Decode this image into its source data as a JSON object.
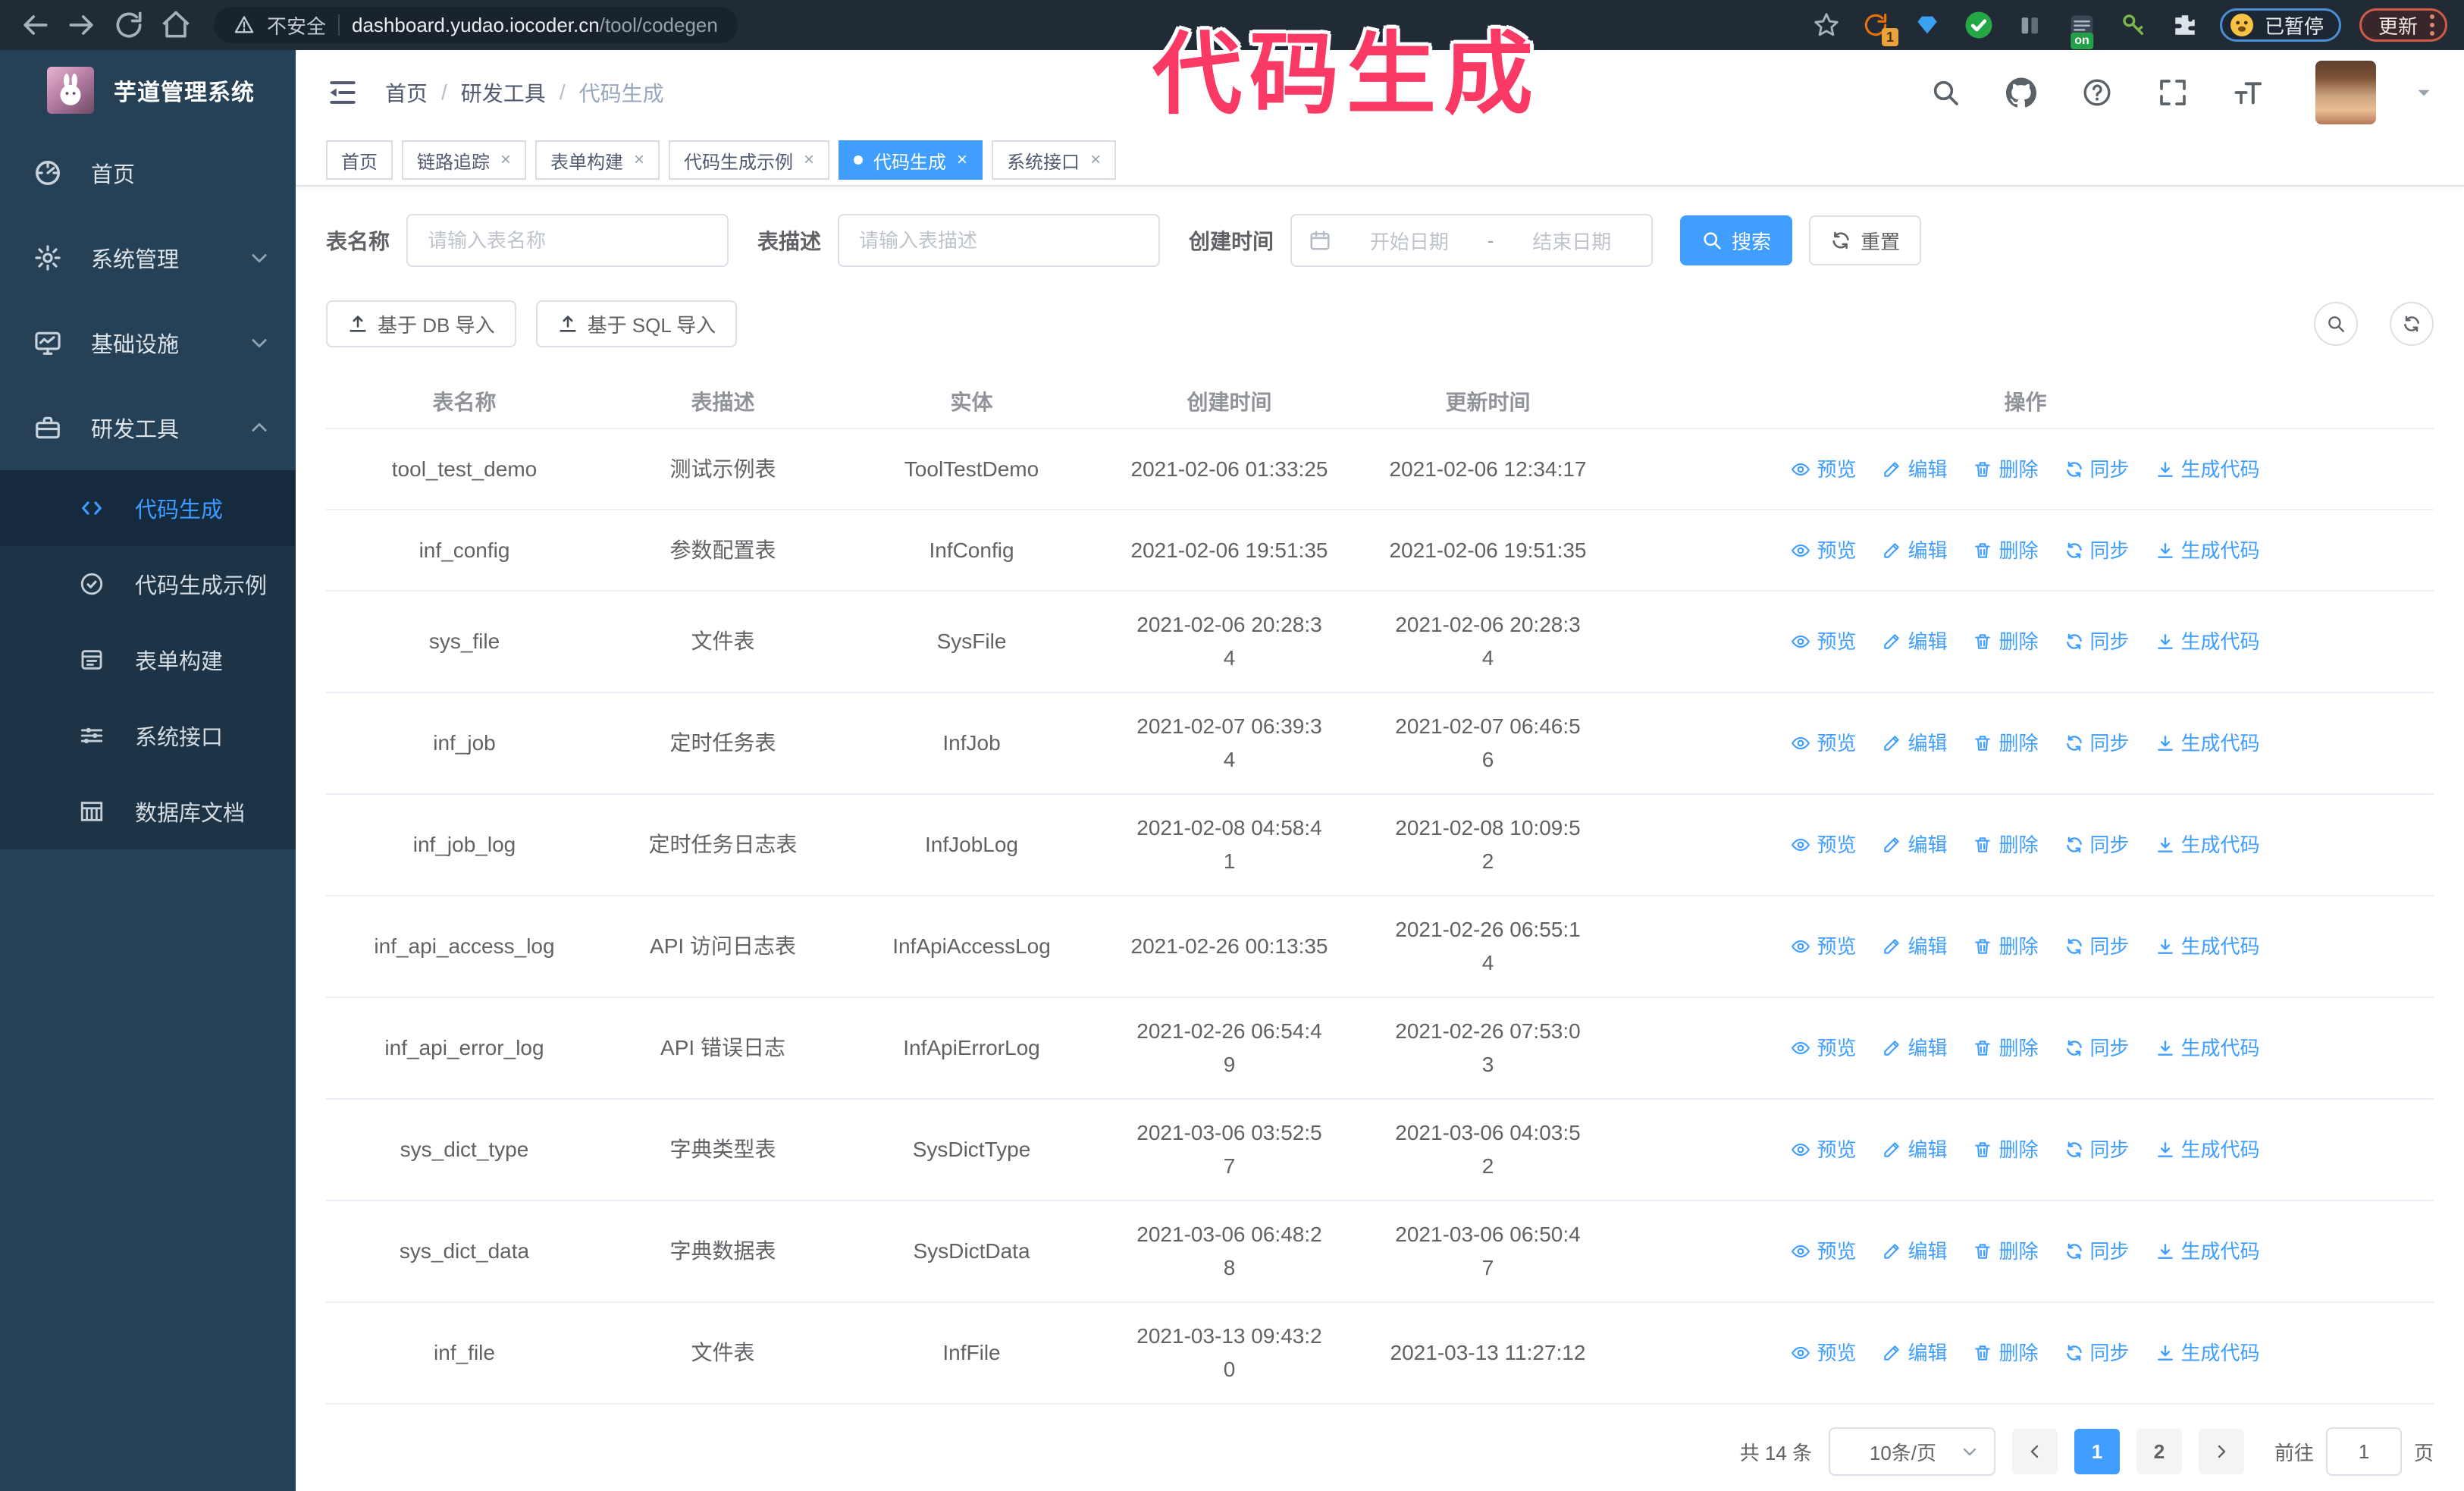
{
  "browser": {
    "security": "不安全",
    "url_host": "dashboard.yudao.iocoder.cn",
    "url_path": "/tool/codegen",
    "ext_badge": "1",
    "ext_on_badge": "on",
    "paused_label": "已暂停",
    "update_label": "更新"
  },
  "overlay_title": "代码生成",
  "sidebar": {
    "title": "芋道管理系统",
    "items": [
      {
        "label": "首页"
      },
      {
        "label": "系统管理"
      },
      {
        "label": "基础设施"
      },
      {
        "label": "研发工具"
      }
    ],
    "sub_items": [
      {
        "label": "代码生成"
      },
      {
        "label": "代码生成示例"
      },
      {
        "label": "表单构建"
      },
      {
        "label": "系统接口"
      },
      {
        "label": "数据库文档"
      }
    ]
  },
  "breadcrumb": [
    "首页",
    "研发工具",
    "代码生成"
  ],
  "tabs": [
    {
      "label": "首页"
    },
    {
      "label": "链路追踪"
    },
    {
      "label": "表单构建"
    },
    {
      "label": "代码生成示例"
    },
    {
      "label": "代码生成"
    },
    {
      "label": "系统接口"
    }
  ],
  "filters": {
    "name_label": "表名称",
    "name_placeholder": "请输入表名称",
    "desc_label": "表描述",
    "desc_placeholder": "请输入表描述",
    "time_label": "创建时间",
    "start_placeholder": "开始日期",
    "range_separator": "-",
    "end_placeholder": "结束日期",
    "search_label": "搜索",
    "reset_label": "重置"
  },
  "toolbar": {
    "import_db_label": "基于 DB 导入",
    "import_sql_label": "基于 SQL 导入"
  },
  "table": {
    "columns": [
      "表名称",
      "表描述",
      "实体",
      "创建时间",
      "更新时间",
      "操作"
    ],
    "actions": [
      "预览",
      "编辑",
      "删除",
      "同步",
      "生成代码"
    ],
    "rows": [
      {
        "name": "tool_test_demo",
        "desc": "测试示例表",
        "entity": "ToolTestDemo",
        "created": "2021-02-06 01:33:25",
        "updated": "2021-02-06 12:34:17"
      },
      {
        "name": "inf_config",
        "desc": "参数配置表",
        "entity": "InfConfig",
        "created": "2021-02-06 19:51:35",
        "updated": "2021-02-06 19:51:35"
      },
      {
        "name": "sys_file",
        "desc": "文件表",
        "entity": "SysFile",
        "created": "2021-02-06 20:28:3\n4",
        "updated": "2021-02-06 20:28:3\n4"
      },
      {
        "name": "inf_job",
        "desc": "定时任务表",
        "entity": "InfJob",
        "created": "2021-02-07 06:39:3\n4",
        "updated": "2021-02-07 06:46:5\n6"
      },
      {
        "name": "inf_job_log",
        "desc": "定时任务日志表",
        "entity": "InfJobLog",
        "created": "2021-02-08 04:58:4\n1",
        "updated": "2021-02-08 10:09:5\n2"
      },
      {
        "name": "inf_api_access_log",
        "desc": "API 访问日志表",
        "entity": "InfApiAccessLog",
        "created": "2021-02-26 00:13:35",
        "updated": "2021-02-26 06:55:1\n4"
      },
      {
        "name": "inf_api_error_log",
        "desc": "API 错误日志",
        "entity": "InfApiErrorLog",
        "created": "2021-02-26 06:54:4\n9",
        "updated": "2021-02-26 07:53:0\n3"
      },
      {
        "name": "sys_dict_type",
        "desc": "字典类型表",
        "entity": "SysDictType",
        "created": "2021-03-06 03:52:5\n7",
        "updated": "2021-03-06 04:03:5\n2"
      },
      {
        "name": "sys_dict_data",
        "desc": "字典数据表",
        "entity": "SysDictData",
        "created": "2021-03-06 06:48:2\n8",
        "updated": "2021-03-06 06:50:4\n7"
      },
      {
        "name": "inf_file",
        "desc": "文件表",
        "entity": "InfFile",
        "created": "2021-03-13 09:43:2\n0",
        "updated": "2021-03-13 11:27:12"
      }
    ]
  },
  "pagination": {
    "total": "共 14 条",
    "page_size": "10条/页",
    "pages": [
      "1",
      "2"
    ],
    "goto_label": "前往",
    "goto_value": "1",
    "page_unit": "页"
  },
  "colors": {
    "primary": "#409eff",
    "overlay_pink": "#fa3964",
    "sidebar_bg": "#264156",
    "submenu_bg": "#1d3346",
    "chrome_bg": "#202b36"
  }
}
